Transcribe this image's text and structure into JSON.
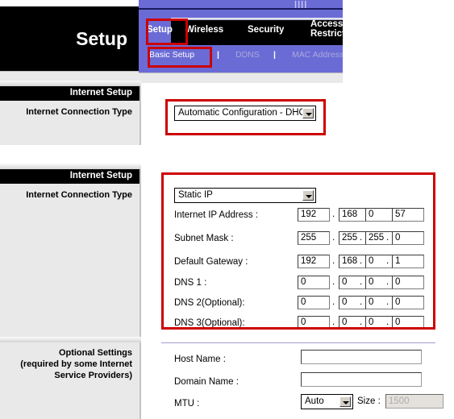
{
  "banner": {
    "title": "Setup"
  },
  "nav": {
    "tabs": [
      {
        "label": "Setup",
        "active": true
      },
      {
        "label": "Wireless",
        "active": false
      },
      {
        "label": "Security",
        "active": false
      },
      {
        "label": "Access",
        "active": false
      },
      {
        "label": "Restrictions",
        "active": false
      }
    ],
    "subtabs": [
      {
        "label": "Basic Setup",
        "active": true
      },
      {
        "label": "DDNS",
        "active": false
      },
      {
        "label": "MAC Address Clone",
        "active": false
      }
    ],
    "separator": "|",
    "purple_color": "#6b6bd6",
    "highlight_color": "#cc0000"
  },
  "section_dhcp": {
    "header": "Internet Setup",
    "label": "Internet Connection Type",
    "connection_type_selected": "Automatic Configuration - DHCP"
  },
  "section_static": {
    "header": "Internet Setup",
    "label": "Internet Connection Type",
    "connection_type_selected": "Static IP",
    "fields": [
      {
        "label": "Internet IP Address :",
        "octets": [
          "192",
          "168",
          "0",
          "57"
        ]
      },
      {
        "label": "Subnet Mask :",
        "octets": [
          "255",
          "255",
          "255",
          "0"
        ]
      },
      {
        "label": "Default Gateway :",
        "octets": [
          "192",
          "168",
          "0",
          "1"
        ]
      },
      {
        "label": "DNS 1 :",
        "octets": [
          "0",
          "0",
          "0",
          "0"
        ]
      },
      {
        "label": "DNS 2(Optional):",
        "octets": [
          "0",
          "0",
          "0",
          "0"
        ]
      },
      {
        "label": "DNS 3(Optional):",
        "octets": [
          "0",
          "0",
          "0",
          "0"
        ]
      }
    ],
    "dot": "."
  },
  "section_optional": {
    "label_line1": "Optional Settings",
    "label_line2": "(required by some Internet",
    "label_line3": "Service Providers)",
    "host_name_label": "Host Name :",
    "host_name_value": "",
    "domain_name_label": "Domain Name :",
    "domain_name_value": "",
    "mtu_label": "MTU :",
    "mtu_selected": "Auto",
    "size_label": "Size :",
    "size_value": "1500"
  }
}
